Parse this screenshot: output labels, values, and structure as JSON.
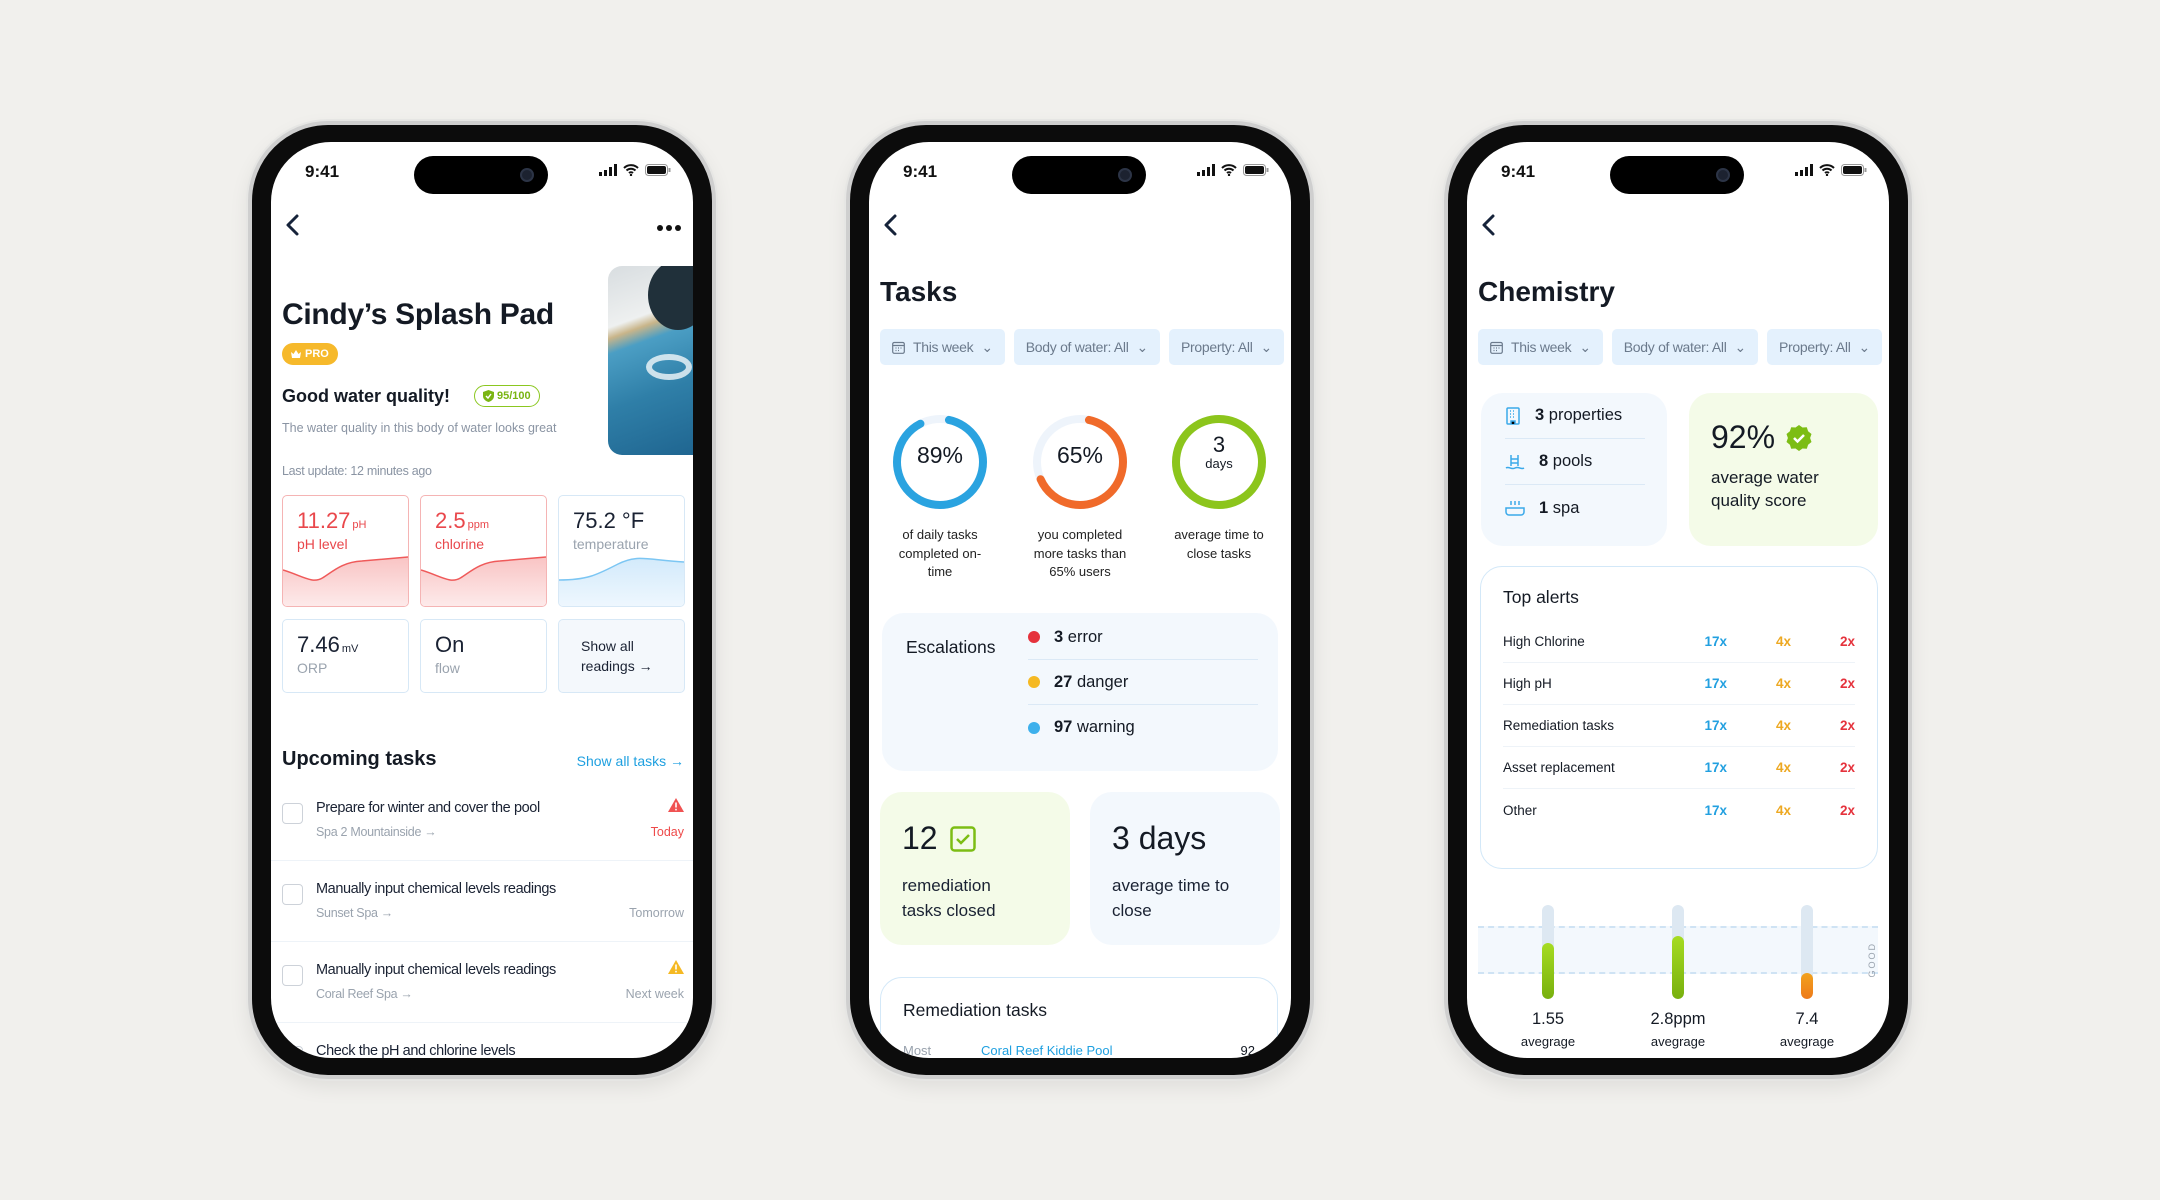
{
  "status_bar": {
    "time": "9:41"
  },
  "pool_detail": {
    "title": "Cindy’s Splash Pad",
    "badge": "PRO",
    "quality_title": "Good water quality!",
    "quality_score": "95/100",
    "quality_desc": "The water quality in this body of water looks great",
    "last_update": "Last update: 12 minutes ago",
    "readings": [
      {
        "value": "11.27",
        "unit": "pH",
        "label": "pH level",
        "status": "alert"
      },
      {
        "value": "2.5",
        "unit": "ppm",
        "label": "chlorine",
        "status": "alert"
      },
      {
        "value": "75.2 °F",
        "unit": "",
        "label": "temperature",
        "status": "normal"
      },
      {
        "value": "7.46",
        "unit": "mV",
        "label": "ORP",
        "status": "normal"
      },
      {
        "value": "On",
        "unit": "",
        "label": "flow",
        "status": "normal"
      }
    ],
    "show_all_readings": "Show all readings →",
    "upcoming_title": "Upcoming tasks",
    "show_all_tasks": "Show all tasks →",
    "tasks": [
      {
        "title": "Prepare for winter and cover the pool",
        "location": "Spa 2 Mountainside →",
        "due": "Today",
        "priority": "high"
      },
      {
        "title": "Manually input chemical levels readings",
        "location": "Sunset Spa →",
        "due": "Tomorrow",
        "priority": "none"
      },
      {
        "title": "Manually input chemical levels readings",
        "location": "Coral Reef Spa →",
        "due": "Next week",
        "priority": "medium"
      },
      {
        "title": "Check the pH and chlorine levels",
        "location": "",
        "due": "",
        "priority": "none"
      }
    ]
  },
  "tasks_screen": {
    "title": "Tasks",
    "filters": [
      "This week",
      "Body of water: All",
      "Property: All"
    ],
    "rings": [
      {
        "value": "89%",
        "caption": "of daily tasks completed on-time",
        "progress": 0.89,
        "color": "#2aa3e0"
      },
      {
        "value": "65%",
        "caption": "you completed more tasks than 65% users",
        "progress": 0.65,
        "color": "#f06a2a"
      },
      {
        "value": "3",
        "unit": "days",
        "caption": "average time to close tasks",
        "progress": 1.0,
        "color": "#8cc51c"
      }
    ],
    "escalations": {
      "label": "Escalations",
      "items": [
        {
          "count": "3",
          "label": "error",
          "color": "#e5323c"
        },
        {
          "count": "27",
          "label": "danger",
          "color": "#f5b923"
        },
        {
          "count": "97",
          "label": "warning",
          "color": "#3db0ec"
        }
      ]
    },
    "stats": [
      {
        "value": "12",
        "label": "remediation tasks closed"
      },
      {
        "value": "3 days",
        "label": "average time to close"
      }
    ],
    "remediation": {
      "title": "Remediation tasks",
      "row_label": "Most",
      "row_link": "Coral Reef Kiddie Pool",
      "row_value": "92"
    }
  },
  "chemistry": {
    "title": "Chemistry",
    "filters": [
      "This week",
      "Body of water: All",
      "Property: All"
    ],
    "summary": [
      {
        "count": "3",
        "label": "properties"
      },
      {
        "count": "8",
        "label": "pools"
      },
      {
        "count": "1",
        "label": "spa"
      }
    ],
    "score": {
      "value": "92%",
      "label": "average water quality score"
    },
    "alerts": {
      "title": "Top alerts",
      "rows": [
        {
          "name": "High Chlorine",
          "counts": [
            "17x",
            "4x",
            "2x"
          ]
        },
        {
          "name": "High pH",
          "counts": [
            "17x",
            "4x",
            "2x"
          ]
        },
        {
          "name": "Remediation tasks",
          "counts": [
            "17x",
            "4x",
            "2x"
          ]
        },
        {
          "name": "Asset replacement",
          "counts": [
            "17x",
            "4x",
            "2x"
          ]
        },
        {
          "name": "Other",
          "counts": [
            "17x",
            "4x",
            "2x"
          ]
        }
      ]
    },
    "band_label": "GOOD",
    "gauges": [
      {
        "value": "1.55",
        "label": "avegrage",
        "level": 0.6,
        "color": "#8cc51c"
      },
      {
        "value": "2.8ppm",
        "label": "avegrage",
        "level": 0.67,
        "color": "#8cc51c"
      },
      {
        "value": "7.4",
        "label": "avegrage",
        "level": 0.28,
        "color": "#f0961f"
      }
    ]
  }
}
